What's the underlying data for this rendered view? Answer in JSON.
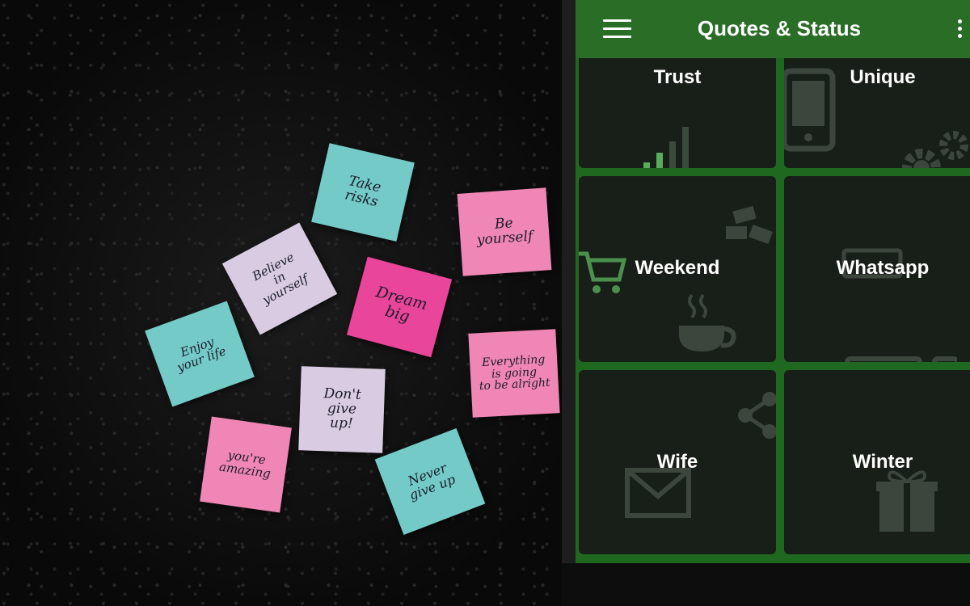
{
  "app": {
    "title": "Quotes & Status",
    "menu_icon": "hamburger-menu-icon",
    "more_icon": "more-vertical-icon"
  },
  "categories": [
    {
      "label": "Trust",
      "icon": "signal-bars-icon"
    },
    {
      "label": "Unique",
      "icon": "smartphone-icon"
    },
    {
      "label": "Weekend",
      "icon": "coffee-cup-icon"
    },
    {
      "label": "Whatsapp",
      "icon": "desktop-computer-icon"
    },
    {
      "label": "Wife",
      "icon": "mail-envelope-icon"
    },
    {
      "label": "Winter",
      "icon": "gift-box-icon"
    }
  ],
  "background_notes": [
    {
      "text": "Take\nrisks",
      "color": "#73cac7"
    },
    {
      "text": "Be\nyourself",
      "color": "#ef86b6"
    },
    {
      "text": "Believe\nin\nyourself",
      "color": "#d9cce2"
    },
    {
      "text": "Dream\nbig",
      "color": "#e9459a"
    },
    {
      "text": "Enjoy\nyour life",
      "color": "#73cac7"
    },
    {
      "text": "Everything\nis going\nto be alright",
      "color": "#ef86b6"
    },
    {
      "text": "Don't\ngive\nup!",
      "color": "#d9cce2"
    },
    {
      "text": "you're\namazing",
      "color": "#ef86b6"
    },
    {
      "text": "Never\ngive up",
      "color": "#73cac7"
    }
  ],
  "colors": {
    "appbar": "#2a6d26",
    "grid_border": "#1e6820",
    "tile": "#171f18",
    "icon_accent": "#6fdc73"
  }
}
